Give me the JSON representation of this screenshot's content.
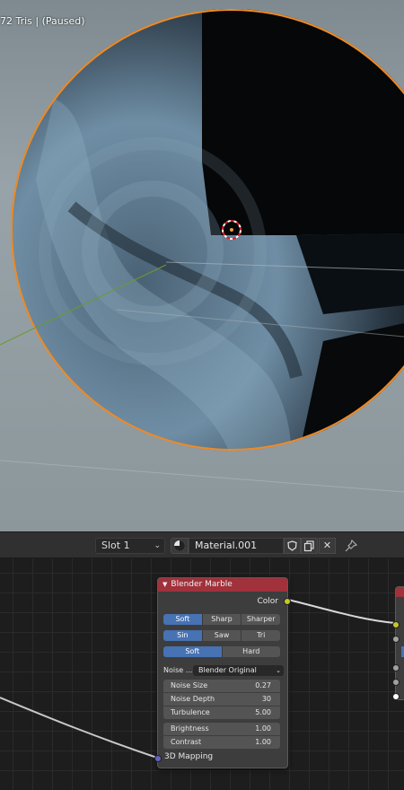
{
  "viewport": {
    "status_text": "72 Tris | (Paused)"
  },
  "header": {
    "slot_label": "Slot 1",
    "material_name": "Material.001",
    "close_label": "✕",
    "pin_label": "⚲"
  },
  "node": {
    "title": "Blender Marble",
    "output_label": "Color",
    "shape_options": [
      "Soft",
      "Sharp",
      "Sharper"
    ],
    "wave_options": [
      "Sin",
      "Saw",
      "Tri"
    ],
    "noise_type_options": [
      "Soft",
      "Hard"
    ],
    "noise_basis_label": "Noise ...",
    "noise_basis_value": "Blender Original",
    "noise_size": {
      "label": "Noise Size",
      "value": "0.27"
    },
    "noise_depth": {
      "label": "Noise Depth",
      "value": "30"
    },
    "turbulence": {
      "label": "Turbulence",
      "value": "5.00"
    },
    "brightness": {
      "label": "Brightness",
      "value": "1.00"
    },
    "contrast": {
      "label": "Contrast",
      "value": "1.00"
    },
    "input_label": "3D Mapping"
  },
  "colors": {
    "node_header": "#a1313b",
    "selected_option": "#4772b3",
    "object_outline": "#f08a24",
    "color_socket": "#c7c729",
    "vector_socket": "#6363c7"
  }
}
